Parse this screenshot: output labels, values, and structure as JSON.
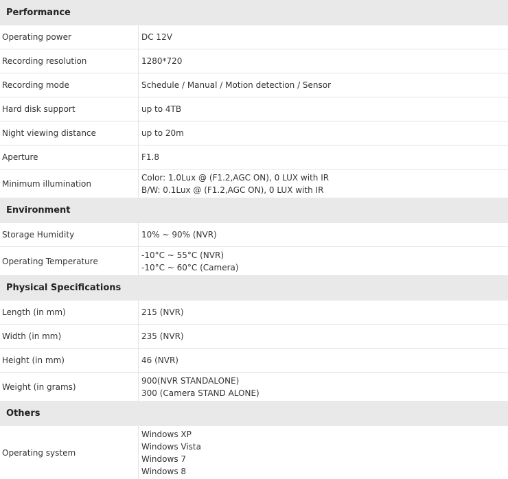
{
  "sections": [
    {
      "title": "Performance",
      "rows": [
        {
          "label": "Operating power",
          "values": [
            "DC 12V"
          ]
        },
        {
          "label": "Recording resolution",
          "values": [
            "1280*720"
          ]
        },
        {
          "label": "Recording mode",
          "values": [
            "Schedule / Manual / Motion detection / Sensor"
          ]
        },
        {
          "label": "Hard disk support",
          "values": [
            "up to 4TB"
          ]
        },
        {
          "label": "Night viewing distance",
          "values": [
            "up to 20m"
          ]
        },
        {
          "label": "Aperture",
          "values": [
            "F1.8"
          ]
        },
        {
          "label": "Minimum illumination",
          "values": [
            "Color: 1.0Lux @ (F1.2,AGC ON), 0 LUX with IR",
            "B/W: 0.1Lux @ (F1.2,AGC ON), 0 LUX with IR"
          ]
        }
      ]
    },
    {
      "title": "Environment",
      "rows": [
        {
          "label": "Storage Humidity",
          "values": [
            "10% ~ 90% (NVR)"
          ]
        },
        {
          "label": "Operating Temperature",
          "values": [
            "-10°C ~ 55°C (NVR)",
            "-10°C ~ 60°C (Camera)"
          ]
        }
      ]
    },
    {
      "title": "Physical Specifications",
      "rows": [
        {
          "label": "Length (in mm)",
          "values": [
            "215 (NVR)"
          ]
        },
        {
          "label": "Width (in mm)",
          "values": [
            "235 (NVR)"
          ]
        },
        {
          "label": "Height (in mm)",
          "values": [
            "46 (NVR)"
          ]
        },
        {
          "label": "Weight (in grams)",
          "values": [
            "900(NVR STANDALONE)",
            "300 (Camera STAND ALONE)"
          ]
        }
      ]
    },
    {
      "title": "Others",
      "rows": [
        {
          "label": "Operating system",
          "values": [
            "Windows XP",
            "Windows Vista",
            "Windows 7",
            "Windows 8"
          ]
        }
      ]
    }
  ]
}
